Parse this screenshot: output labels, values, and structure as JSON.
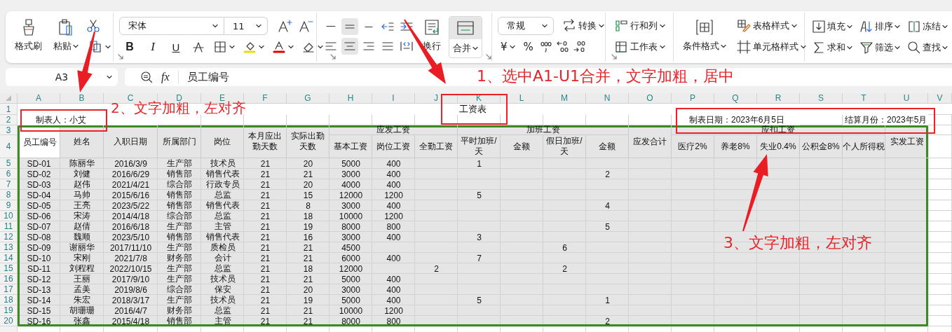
{
  "ribbon": {
    "clipboard": {
      "format_painter": "格式刷",
      "paste": "粘贴"
    },
    "font": {
      "font_name": "宋体",
      "font_size": "11",
      "style_buttons": [
        {
          "label": "B",
          "kind": "bold"
        },
        {
          "label": "I",
          "kind": "italic"
        },
        {
          "label": "U",
          "kind": "underline"
        }
      ]
    },
    "alignment": {
      "buttons": [
        {
          "selected": false
        },
        {
          "selected": true
        },
        {
          "selected": false
        },
        {
          "selected": false
        },
        {
          "selected": false
        },
        {
          "selected": false
        },
        {
          "selected": true
        },
        {
          "selected": false
        },
        {
          "selected": false
        },
        {
          "selected": false
        }
      ],
      "wrap": "换行",
      "merge": {
        "label": "合并",
        "selected": true
      }
    },
    "number": {
      "format": "常规",
      "convert": "转换",
      "currency": "¥",
      "percent": "%"
    },
    "cells": {
      "rows_columns": "行和列",
      "worksheet": "工作表"
    },
    "styles": {
      "conditional_format": "条件格式",
      "table_style": "表格样式",
      "cell_style": "单元格样式"
    },
    "editing": [
      {
        "label": "填充"
      },
      {
        "label": "排序"
      },
      {
        "label": "冻结"
      },
      {
        "label": "求和"
      },
      {
        "label": "筛选"
      },
      {
        "label": "查找"
      }
    ]
  },
  "formula_bar": {
    "name_box": "A3",
    "fx": "fx",
    "content": "员工编号"
  },
  "sheet": {
    "column_headers": [
      "A",
      "B",
      "C",
      "D",
      "E",
      "F",
      "G",
      "H",
      "I",
      "J",
      "K",
      "L",
      "M",
      "N",
      "O",
      "P",
      "Q",
      "R",
      "S",
      "T",
      "U",
      "V"
    ],
    "row_headers": [
      "1",
      "2",
      "3",
      "4",
      "5",
      "6",
      "7",
      "8",
      "9",
      "10",
      "11",
      "12",
      "13",
      "14",
      "15",
      "16",
      "17",
      "18",
      "19",
      "20"
    ],
    "title": "工资表",
    "info": [
      {
        "text": "制表人：小艾"
      },
      {
        "text": "制表日期：2023年6月5日"
      },
      {
        "text": "结算月份：2023年5月"
      }
    ],
    "header_groups": [
      {
        "label": "员工编号",
        "selected": true
      },
      {
        "label": "姓名",
        "selected": false
      },
      {
        "label": "入职日期",
        "selected": false
      },
      {
        "label": "所属部门",
        "selected": false
      },
      {
        "label": "岗位",
        "selected": false
      },
      {
        "label": "本月应出勤天数",
        "selected": false,
        "wrap": true
      },
      {
        "label": "实际出勤天数",
        "selected": false,
        "wrap": true
      },
      {
        "label": "应发工资",
        "selected": false,
        "children": [
          {
            "label": "基本工资",
            "selected": false
          },
          {
            "label": "岗位工资",
            "selected": false
          },
          {
            "label": "全勤工资",
            "selected": false
          }
        ]
      },
      {
        "label": "加班工资",
        "selected": false,
        "children": [
          {
            "label": "平时加班/天",
            "selected": false,
            "wrap": true
          },
          {
            "label": "金额",
            "selected": false
          },
          {
            "label": "假日加班/天",
            "selected": false,
            "wrap": true
          },
          {
            "label": "金额",
            "selected": false
          }
        ]
      },
      {
        "label": "应发合计",
        "selected": false
      },
      {
        "label": "应扣工资",
        "selected": false,
        "children": [
          {
            "label": "医疗2%",
            "selected": false
          },
          {
            "label": "养老8%",
            "selected": false
          },
          {
            "label": "失业0.4%",
            "selected": false
          },
          {
            "label": "公积金8%",
            "selected": false
          },
          {
            "label": "个人所得税",
            "selected": false
          }
        ]
      },
      {
        "label": "实发工资",
        "selected": false
      }
    ],
    "rows": [
      {
        "cells": {
          "A": "SD-01",
          "B": "陈丽华",
          "C": "2016/3/9",
          "D": "生产部",
          "E": "技术员",
          "F": "21",
          "G": "20",
          "H": "5000",
          "I": "400",
          "K": "1"
        }
      },
      {
        "cells": {
          "A": "SD-02",
          "B": "刘健",
          "C": "2016/6/29",
          "D": "销售部",
          "E": "销售代表",
          "F": "21",
          "G": "21",
          "H": "3000",
          "I": "400",
          "N": "2"
        }
      },
      {
        "cells": {
          "A": "SD-03",
          "B": "赵伟",
          "C": "2021/4/21",
          "D": "综合部",
          "E": "行政专员",
          "F": "21",
          "G": "20",
          "H": "4000",
          "I": "400"
        }
      },
      {
        "cells": {
          "A": "SD-04",
          "B": "马帅",
          "C": "2015/6/16",
          "D": "销售部",
          "E": "总监",
          "F": "21",
          "G": "15",
          "H": "12000",
          "I": "1200",
          "K": "5"
        }
      },
      {
        "cells": {
          "A": "SD-05",
          "B": "王亮",
          "C": "2023/5/22",
          "D": "销售部",
          "E": "销售代表",
          "F": "21",
          "G": "8",
          "H": "3000",
          "I": "400",
          "N": "4"
        }
      },
      {
        "cells": {
          "A": "SD-06",
          "B": "宋涛",
          "C": "2014/4/18",
          "D": "综合部",
          "E": "总监",
          "F": "21",
          "G": "18",
          "H": "10000",
          "I": "1200"
        }
      },
      {
        "cells": {
          "A": "SD-07",
          "B": "赵倩",
          "C": "2016/6/18",
          "D": "生产部",
          "E": "主管",
          "F": "21",
          "G": "19",
          "H": "8000",
          "I": "800",
          "N": "5"
        }
      },
      {
        "cells": {
          "A": "SD-08",
          "B": "魏顺",
          "C": "2023/5/10",
          "D": "销售部",
          "E": "销售代表",
          "F": "21",
          "G": "16",
          "H": "3000",
          "I": "400",
          "K": "3"
        }
      },
      {
        "cells": {
          "A": "SD-09",
          "B": "谢丽华",
          "C": "2017/11/10",
          "D": "生产部",
          "E": "质检员",
          "F": "21",
          "G": "21",
          "H": "4500",
          "M": "6"
        }
      },
      {
        "cells": {
          "A": "SD-10",
          "B": "宋刚",
          "C": "2021/7/8",
          "D": "财务部",
          "E": "会计",
          "F": "21",
          "G": "21",
          "H": "6000",
          "I": "400",
          "K": "7"
        }
      },
      {
        "cells": {
          "A": "SD-11",
          "B": "刘程程",
          "C": "2022/10/15",
          "D": "生产部",
          "E": "总监",
          "F": "21",
          "G": "18",
          "H": "12000",
          "J": "2",
          "M": "2"
        }
      },
      {
        "cells": {
          "A": "SD-12",
          "B": "王丽",
          "C": "2017/9/10",
          "D": "生产部",
          "E": "技术员",
          "F": "21",
          "G": "21",
          "H": "5000",
          "I": "400"
        }
      },
      {
        "cells": {
          "A": "SD-13",
          "B": "孟美",
          "C": "2019/8/6",
          "D": "综合部",
          "E": "保安",
          "F": "21",
          "G": "20",
          "H": "3000",
          "I": "400"
        }
      },
      {
        "cells": {
          "A": "SD-14",
          "B": "朱宏",
          "C": "2018/3/17",
          "D": "生产部",
          "E": "技术员",
          "F": "21",
          "G": "19",
          "H": "5000",
          "I": "400",
          "K": "5",
          "N": "1"
        }
      },
      {
        "cells": {
          "A": "SD-15",
          "B": "胡珊珊",
          "C": "2016/4/7",
          "D": "财务部",
          "E": "总监",
          "F": "21",
          "G": "21",
          "H": "10000",
          "I": "1200"
        }
      },
      {
        "cells": {
          "A": "SD-16",
          "B": "张鑫",
          "C": "2015/4/18",
          "D": "销售部",
          "E": "主管",
          "F": "21",
          "G": "21",
          "H": "8000",
          "I": "800",
          "N": "2"
        }
      }
    ]
  },
  "annotations": [
    {
      "text": "1、选中A1-U1合并，文字加粗，居中"
    },
    {
      "text": "2、文字加粗，左对齐"
    },
    {
      "text": "3、文字加粗，左对齐"
    }
  ]
}
